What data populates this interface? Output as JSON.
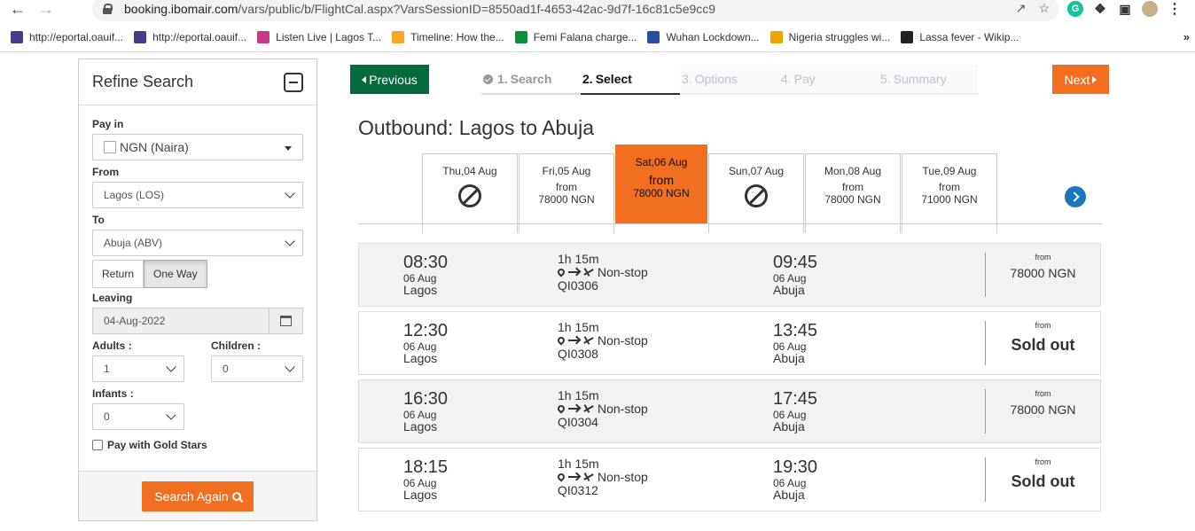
{
  "browser": {
    "url_host": "booking.ibomair.com",
    "url_path": "/vars/public/b/FlightCal.aspx?VarsSessionID=8550ad1f-4653-42ac-9d7f-16c81c5e9cc9",
    "bookmarks": [
      {
        "label": "http://eportal.oauif...",
        "color": "#4a3a8a"
      },
      {
        "label": "http://eportal.oauif...",
        "color": "#4a3a8a"
      },
      {
        "label": "Listen Live | Lagos T...",
        "color": "#c8398a"
      },
      {
        "label": "Timeline: How the...",
        "color": "#f5a623"
      },
      {
        "label": "Femi Falana charge...",
        "color": "#0b8f3a"
      },
      {
        "label": "Wuhan Lockdown...",
        "color": "#2a4f9a"
      },
      {
        "label": "Nigeria struggles wi...",
        "color": "#f0a500"
      },
      {
        "label": "Lassa fever - Wikip...",
        "color": "#222222"
      }
    ]
  },
  "sidebar": {
    "title": "Refine Search",
    "pay_in_label": "Pay in",
    "pay_in_value": "NGN (Naira)",
    "from_label": "From",
    "from_value": "Lagos (LOS)",
    "to_label": "To",
    "to_value": "Abuja (ABV)",
    "trip_return": "Return",
    "trip_oneway": "One Way",
    "leaving_label": "Leaving",
    "leaving_value": "04-Aug-2022",
    "adults_label": "Adults",
    "adults_value": "1",
    "children_label": "Children",
    "children_value": "0",
    "infants_label": "Infants",
    "infants_value": "0",
    "colon": ":",
    "gold_stars": "Pay with Gold Stars",
    "search_again": "Search Again"
  },
  "nav": {
    "previous": "Previous",
    "next": "Next",
    "steps": [
      {
        "num": "1.",
        "label": "Search"
      },
      {
        "num": "2.",
        "label": "Select"
      },
      {
        "num": "3.",
        "label": "Options"
      },
      {
        "num": "4.",
        "label": "Pay"
      },
      {
        "num": "5.",
        "label": "Summary"
      }
    ]
  },
  "outbound_title": "Outbound: Lagos to Abuja",
  "dates": [
    {
      "day": "Thu,04 Aug",
      "from": "",
      "price": ""
    },
    {
      "day": "Fri,05 Aug",
      "from": "from",
      "price": "78000 NGN"
    },
    {
      "day": "Sat,06 Aug",
      "from": "from",
      "price": "78000 NGN"
    },
    {
      "day": "Sun,07 Aug",
      "from": "",
      "price": ""
    },
    {
      "day": "Mon,08 Aug",
      "from": "from",
      "price": "78000 NGN"
    },
    {
      "day": "Tue,09 Aug",
      "from": "from",
      "price": "71000 NGN"
    }
  ],
  "flights": [
    {
      "dep_time": "08:30",
      "dep_date": "06 Aug",
      "dep_city": "Lagos",
      "duration": "1h 15m",
      "stops": "Non-stop",
      "number": "QI0306",
      "arr_time": "09:45",
      "arr_date": "06 Aug",
      "arr_city": "Abuja",
      "from": "from",
      "price": "78000 NGN"
    },
    {
      "dep_time": "12:30",
      "dep_date": "06 Aug",
      "dep_city": "Lagos",
      "duration": "1h 15m",
      "stops": "Non-stop",
      "number": "QI0308",
      "arr_time": "13:45",
      "arr_date": "06 Aug",
      "arr_city": "Abuja",
      "from": "from",
      "price": "Sold out"
    },
    {
      "dep_time": "16:30",
      "dep_date": "06 Aug",
      "dep_city": "Lagos",
      "duration": "1h 15m",
      "stops": "Non-stop",
      "number": "QI0304",
      "arr_time": "17:45",
      "arr_date": "06 Aug",
      "arr_city": "Abuja",
      "from": "from",
      "price": "78000 NGN"
    },
    {
      "dep_time": "18:15",
      "dep_date": "06 Aug",
      "dep_city": "Lagos",
      "duration": "1h 15m",
      "stops": "Non-stop",
      "number": "QI0312",
      "arr_time": "19:30",
      "arr_date": "06 Aug",
      "arr_city": "Abuja",
      "from": "from",
      "price": "Sold out"
    }
  ],
  "colors": {
    "brand_green": "#046a3e",
    "brand_orange": "#f26f21",
    "link_blue": "#1b76bc"
  }
}
